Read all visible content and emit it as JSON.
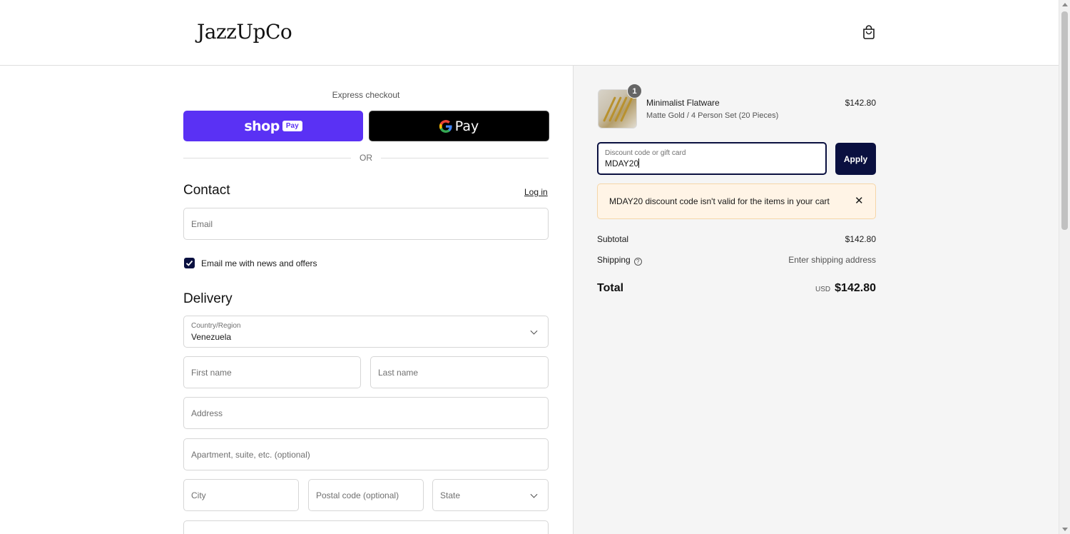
{
  "header": {
    "logo": "JazzUpCo",
    "cart_icon": "shopping-bag-icon"
  },
  "express": {
    "label": "Express checkout",
    "shop_pay": {
      "text": "shop",
      "badge": "Pay",
      "color": "#5a31f4"
    },
    "gpay": {
      "text": "Pay"
    },
    "divider": "OR"
  },
  "contact": {
    "title": "Contact",
    "login_label": "Log in",
    "email_placeholder": "Email",
    "newsletter_label": "Email me with news and offers",
    "newsletter_checked": true
  },
  "delivery": {
    "title": "Delivery",
    "country_label": "Country/Region",
    "country_value": "Venezuela",
    "first_name_placeholder": "First name",
    "last_name_placeholder": "Last name",
    "address_placeholder": "Address",
    "apartment_placeholder": "Apartment, suite, etc. (optional)",
    "city_placeholder": "City",
    "postal_placeholder": "Postal code (optional)",
    "state_placeholder": "State"
  },
  "summary": {
    "item": {
      "quantity": "1",
      "name": "Minimalist Flatware",
      "variant": "Matte Gold / 4 Person Set (20 Pieces)",
      "price": "$142.80"
    },
    "discount": {
      "label": "Discount code or gift card",
      "value": "MDAY20",
      "apply_label": "Apply"
    },
    "error": {
      "message": "MDAY20 discount code isn't valid for the items in your cart",
      "close": "✕"
    },
    "subtotal_label": "Subtotal",
    "subtotal_value": "$142.80",
    "shipping_label": "Shipping",
    "shipping_value": "Enter shipping address",
    "total_label": "Total",
    "currency": "USD",
    "total_value": "$142.80"
  },
  "colors": {
    "primary": "#0a1040",
    "shop_pay": "#5a31f4",
    "error_bg": "#fff4e6",
    "summary_bg": "#f5f5f5"
  }
}
